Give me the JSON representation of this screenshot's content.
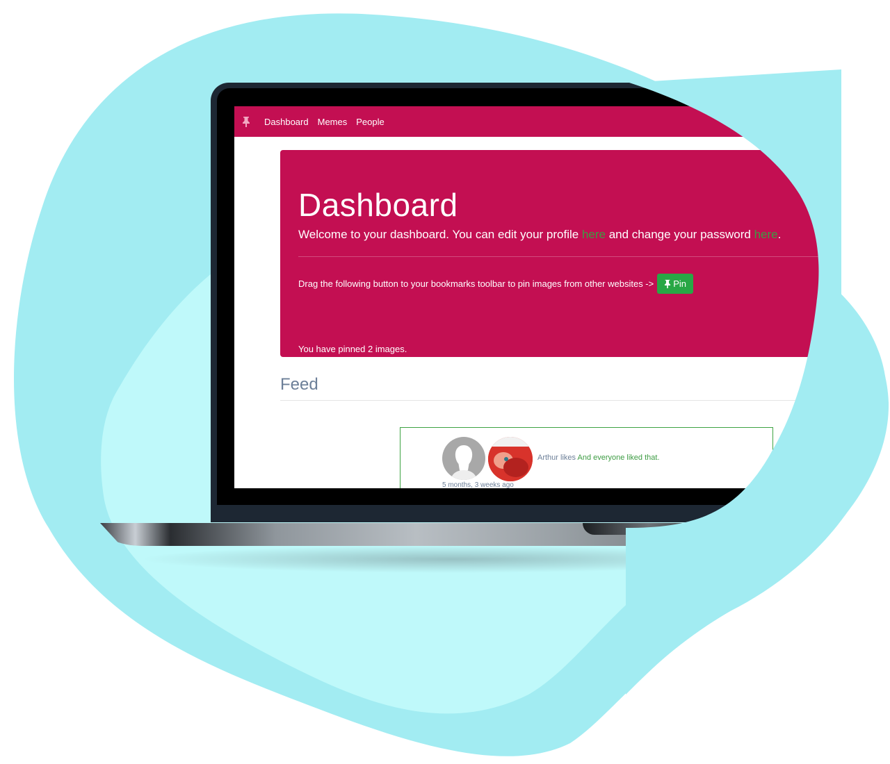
{
  "nav": {
    "items": [
      "Dashboard",
      "Memes",
      "People"
    ]
  },
  "jumbotron": {
    "title": "Dashboard",
    "lead_start": "Welcome to your dashboard. You can edit your profile ",
    "lead_link1": "here",
    "lead_middle": " and change your password ",
    "lead_link2": "here",
    "lead_end": ".",
    "drag_text": "Drag the following button to your bookmarks toolbar to pin images from other websites ->",
    "pin_button": "Pin",
    "pinned_count": "You have pinned 2 images."
  },
  "feed": {
    "title": "Feed",
    "items": [
      {
        "actor": "Arthur likes",
        "message": "And everyone liked that.",
        "time": "5 months, 3 weeks ago"
      }
    ]
  },
  "colors": {
    "brand": "#c30f52",
    "success": "#28a745",
    "link": "#3d9c43",
    "muted": "#6c7f98"
  }
}
